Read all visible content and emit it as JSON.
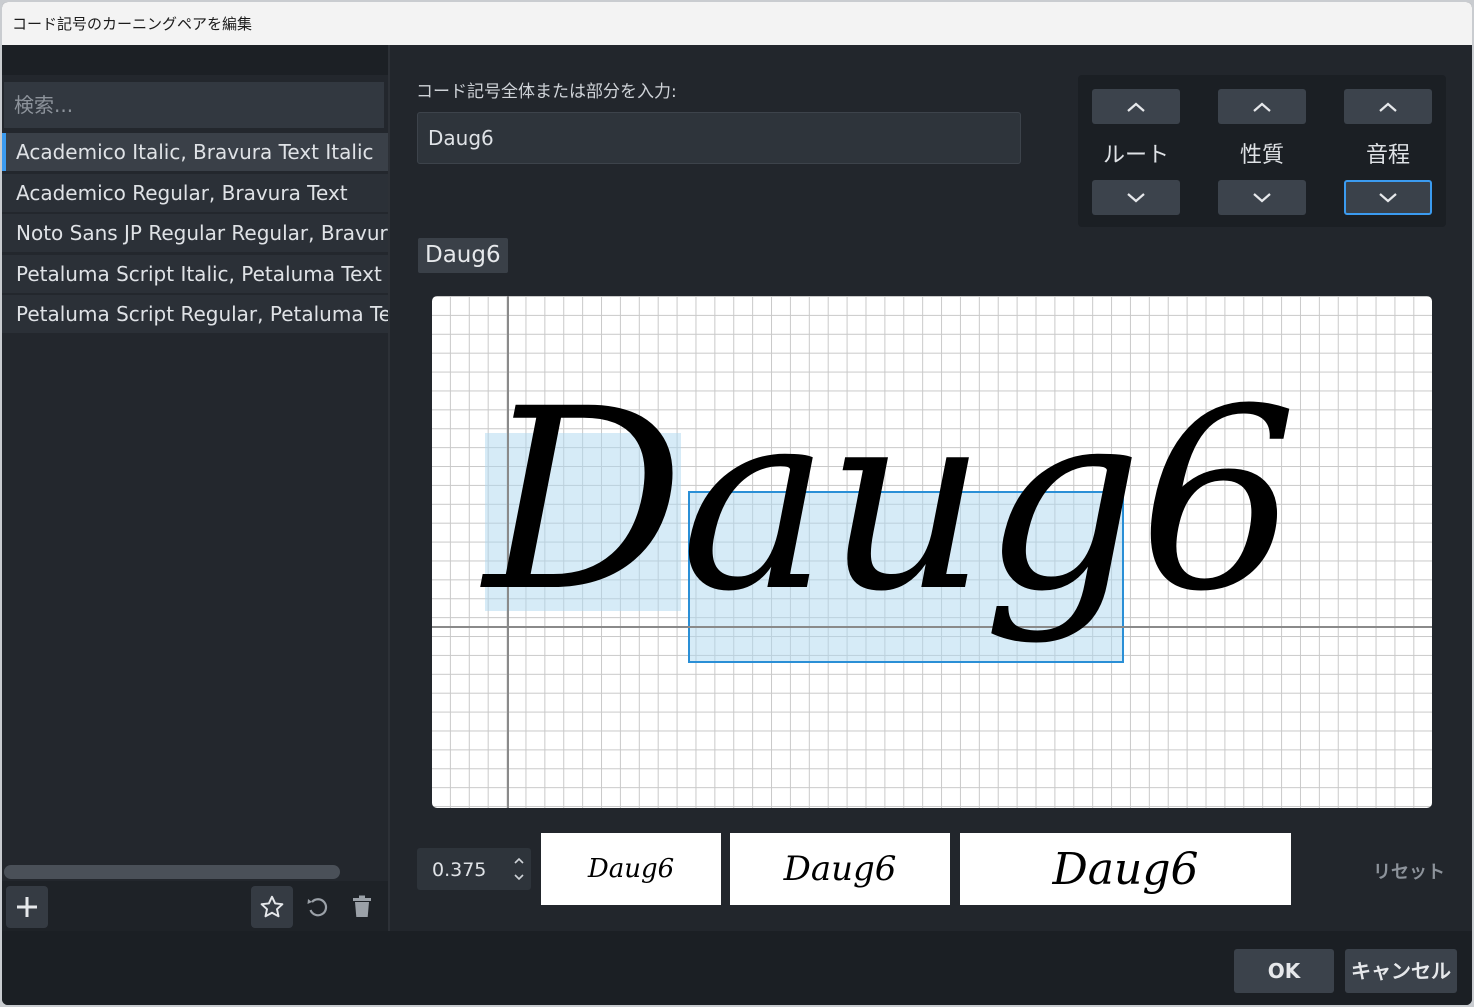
{
  "window": {
    "title": "コード記号のカーニングペアを編集"
  },
  "sidebar": {
    "search_placeholder": "検索...",
    "items": [
      {
        "label": "Academico Italic, Bravura Text Italic",
        "selected": true
      },
      {
        "label": "Academico Regular, Bravura Text",
        "selected": false
      },
      {
        "label": "Noto Sans JP Regular Regular, Bravura Text",
        "selected": false
      },
      {
        "label": "Petaluma Script Italic, Petaluma Text Italic",
        "selected": false
      },
      {
        "label": "Petaluma Script Regular, Petaluma Text",
        "selected": false
      }
    ],
    "footer": {
      "add_icon": "plus-icon",
      "favorite_icon": "star-icon",
      "revert_icon": "revert-icon",
      "delete_icon": "trash-icon"
    }
  },
  "main": {
    "input_label": "コード記号全体または部分を入力:",
    "input_value": "Daug6",
    "controls": [
      {
        "label": "ルート"
      },
      {
        "label": "性質"
      },
      {
        "label": "音程"
      }
    ],
    "selected_tag": "Daug6",
    "glyph_text": "Daug6",
    "spin_value": "0.375",
    "previews": [
      "Daug6",
      "Daug6",
      "Daug6"
    ],
    "reset_label": "リセット"
  },
  "footer": {
    "ok_label": "OK",
    "cancel_label": "キャンセル"
  },
  "colors": {
    "accent": "#3b9bf0",
    "highlight": "#add8f0",
    "selection_border": "#2a8fd6"
  }
}
